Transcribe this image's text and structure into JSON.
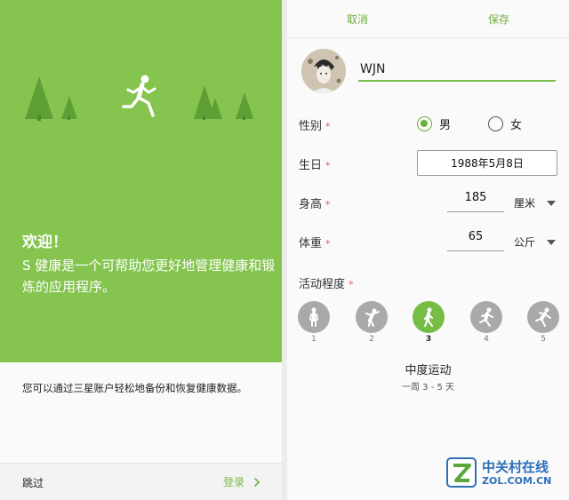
{
  "welcome": {
    "title": "欢迎！",
    "description": "S 健康是一个可帮助您更好地管理健康和锻炼的应用程序。",
    "backup_note": "您可以通过三星账户轻松地备份和恢复健康数据。",
    "skip_label": "跳过",
    "login_label": "登录",
    "accent_color": "#84c44f"
  },
  "profile": {
    "cancel_label": "取消",
    "save_label": "保存",
    "name_value": "WJN",
    "gender": {
      "label": "性别",
      "options": [
        "男",
        "女"
      ],
      "selected": "男"
    },
    "birthday": {
      "label": "生日",
      "value": "1988年5月8日"
    },
    "height": {
      "label": "身高",
      "value": "185",
      "unit": "厘米"
    },
    "weight": {
      "label": "体重",
      "value": "65",
      "unit": "公斤"
    },
    "activity": {
      "label": "活动程度",
      "levels": [
        "1",
        "2",
        "3",
        "4",
        "5"
      ],
      "selected": "3",
      "selected_title": "中度运动",
      "selected_desc": "一周 3 - 5 天"
    },
    "required_mark": "*"
  },
  "watermark": {
    "line1": "中关村在线",
    "line2": "ZOL.COM.CN"
  }
}
